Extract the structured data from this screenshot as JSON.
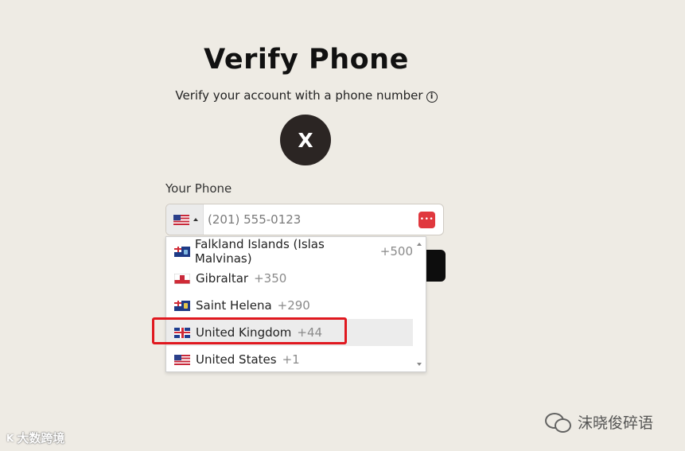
{
  "page": {
    "title": "Verify Phone",
    "subtitle": "Verify your account with a phone number",
    "info_icon": "ⓘ",
    "avatar_letter": "X"
  },
  "phone": {
    "label": "Your Phone",
    "placeholder": "(201) 555-0123",
    "selected_country_flag": "us-flag-icon",
    "password_manager_icon": "•••"
  },
  "dropdown": {
    "items": [
      {
        "name": "Falkland Islands (Islas Malvinas)",
        "code": "+500",
        "flag": "fk-flag-icon"
      },
      {
        "name": "Gibraltar",
        "code": "+350",
        "flag": "gi-flag-icon"
      },
      {
        "name": "Saint Helena",
        "code": "+290",
        "flag": "sh-flag-icon"
      },
      {
        "name": "United Kingdom",
        "code": "+44",
        "flag": "gb-flag-icon"
      },
      {
        "name": "United States",
        "code": "+1",
        "flag": "us-flag-icon"
      }
    ],
    "highlighted_index": 3
  },
  "watermarks": {
    "right_text": "沫晓俊碎语",
    "left_logo": "K",
    "left_text": "大数跨境"
  },
  "colors": {
    "background": "#eeebe4",
    "avatar": "#2b2523",
    "highlight_box": "#e0181f"
  }
}
